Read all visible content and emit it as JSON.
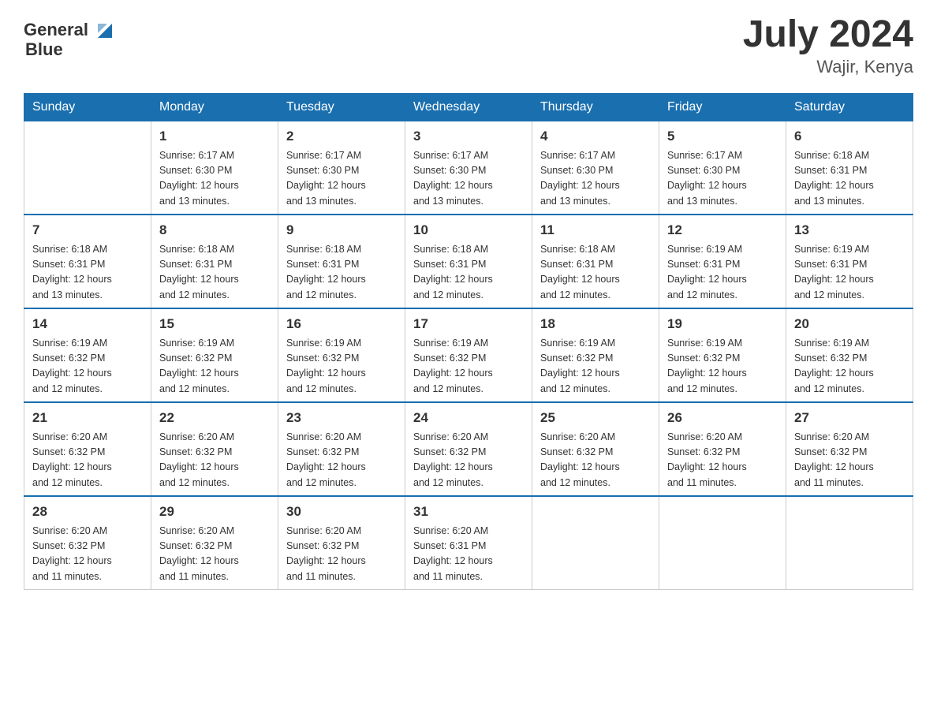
{
  "header": {
    "logo_text_general": "General",
    "logo_text_blue": "Blue",
    "month_year": "July 2024",
    "location": "Wajir, Kenya"
  },
  "days_of_week": [
    "Sunday",
    "Monday",
    "Tuesday",
    "Wednesday",
    "Thursday",
    "Friday",
    "Saturday"
  ],
  "weeks": [
    [
      {
        "day": "",
        "info": ""
      },
      {
        "day": "1",
        "info": "Sunrise: 6:17 AM\nSunset: 6:30 PM\nDaylight: 12 hours\nand 13 minutes."
      },
      {
        "day": "2",
        "info": "Sunrise: 6:17 AM\nSunset: 6:30 PM\nDaylight: 12 hours\nand 13 minutes."
      },
      {
        "day": "3",
        "info": "Sunrise: 6:17 AM\nSunset: 6:30 PM\nDaylight: 12 hours\nand 13 minutes."
      },
      {
        "day": "4",
        "info": "Sunrise: 6:17 AM\nSunset: 6:30 PM\nDaylight: 12 hours\nand 13 minutes."
      },
      {
        "day": "5",
        "info": "Sunrise: 6:17 AM\nSunset: 6:30 PM\nDaylight: 12 hours\nand 13 minutes."
      },
      {
        "day": "6",
        "info": "Sunrise: 6:18 AM\nSunset: 6:31 PM\nDaylight: 12 hours\nand 13 minutes."
      }
    ],
    [
      {
        "day": "7",
        "info": "Sunrise: 6:18 AM\nSunset: 6:31 PM\nDaylight: 12 hours\nand 13 minutes."
      },
      {
        "day": "8",
        "info": "Sunrise: 6:18 AM\nSunset: 6:31 PM\nDaylight: 12 hours\nand 12 minutes."
      },
      {
        "day": "9",
        "info": "Sunrise: 6:18 AM\nSunset: 6:31 PM\nDaylight: 12 hours\nand 12 minutes."
      },
      {
        "day": "10",
        "info": "Sunrise: 6:18 AM\nSunset: 6:31 PM\nDaylight: 12 hours\nand 12 minutes."
      },
      {
        "day": "11",
        "info": "Sunrise: 6:18 AM\nSunset: 6:31 PM\nDaylight: 12 hours\nand 12 minutes."
      },
      {
        "day": "12",
        "info": "Sunrise: 6:19 AM\nSunset: 6:31 PM\nDaylight: 12 hours\nand 12 minutes."
      },
      {
        "day": "13",
        "info": "Sunrise: 6:19 AM\nSunset: 6:31 PM\nDaylight: 12 hours\nand 12 minutes."
      }
    ],
    [
      {
        "day": "14",
        "info": "Sunrise: 6:19 AM\nSunset: 6:32 PM\nDaylight: 12 hours\nand 12 minutes."
      },
      {
        "day": "15",
        "info": "Sunrise: 6:19 AM\nSunset: 6:32 PM\nDaylight: 12 hours\nand 12 minutes."
      },
      {
        "day": "16",
        "info": "Sunrise: 6:19 AM\nSunset: 6:32 PM\nDaylight: 12 hours\nand 12 minutes."
      },
      {
        "day": "17",
        "info": "Sunrise: 6:19 AM\nSunset: 6:32 PM\nDaylight: 12 hours\nand 12 minutes."
      },
      {
        "day": "18",
        "info": "Sunrise: 6:19 AM\nSunset: 6:32 PM\nDaylight: 12 hours\nand 12 minutes."
      },
      {
        "day": "19",
        "info": "Sunrise: 6:19 AM\nSunset: 6:32 PM\nDaylight: 12 hours\nand 12 minutes."
      },
      {
        "day": "20",
        "info": "Sunrise: 6:19 AM\nSunset: 6:32 PM\nDaylight: 12 hours\nand 12 minutes."
      }
    ],
    [
      {
        "day": "21",
        "info": "Sunrise: 6:20 AM\nSunset: 6:32 PM\nDaylight: 12 hours\nand 12 minutes."
      },
      {
        "day": "22",
        "info": "Sunrise: 6:20 AM\nSunset: 6:32 PM\nDaylight: 12 hours\nand 12 minutes."
      },
      {
        "day": "23",
        "info": "Sunrise: 6:20 AM\nSunset: 6:32 PM\nDaylight: 12 hours\nand 12 minutes."
      },
      {
        "day": "24",
        "info": "Sunrise: 6:20 AM\nSunset: 6:32 PM\nDaylight: 12 hours\nand 12 minutes."
      },
      {
        "day": "25",
        "info": "Sunrise: 6:20 AM\nSunset: 6:32 PM\nDaylight: 12 hours\nand 12 minutes."
      },
      {
        "day": "26",
        "info": "Sunrise: 6:20 AM\nSunset: 6:32 PM\nDaylight: 12 hours\nand 11 minutes."
      },
      {
        "day": "27",
        "info": "Sunrise: 6:20 AM\nSunset: 6:32 PM\nDaylight: 12 hours\nand 11 minutes."
      }
    ],
    [
      {
        "day": "28",
        "info": "Sunrise: 6:20 AM\nSunset: 6:32 PM\nDaylight: 12 hours\nand 11 minutes."
      },
      {
        "day": "29",
        "info": "Sunrise: 6:20 AM\nSunset: 6:32 PM\nDaylight: 12 hours\nand 11 minutes."
      },
      {
        "day": "30",
        "info": "Sunrise: 6:20 AM\nSunset: 6:32 PM\nDaylight: 12 hours\nand 11 minutes."
      },
      {
        "day": "31",
        "info": "Sunrise: 6:20 AM\nSunset: 6:31 PM\nDaylight: 12 hours\nand 11 minutes."
      },
      {
        "day": "",
        "info": ""
      },
      {
        "day": "",
        "info": ""
      },
      {
        "day": "",
        "info": ""
      }
    ]
  ]
}
